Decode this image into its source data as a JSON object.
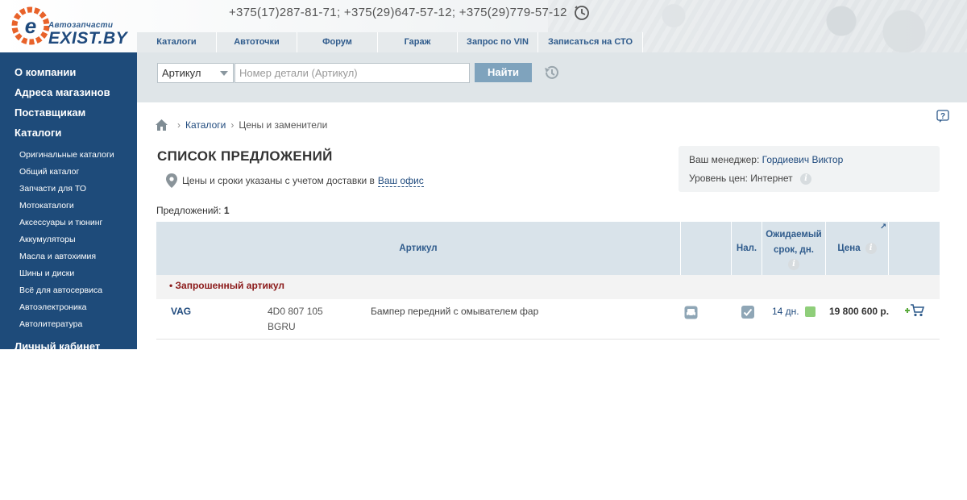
{
  "header": {
    "logo_small": "Автозапчасти",
    "logo_big": "EXIST.BY",
    "phones": "+375(17)287-81-71; +375(29)647-57-12; +375(29)779-57-12",
    "clock_icon": "clock-icon"
  },
  "topnav": [
    {
      "label": "Каталоги"
    },
    {
      "label": "Автоточки"
    },
    {
      "label": "Форум"
    },
    {
      "label": "Гараж"
    },
    {
      "label": "Запрос по VIN"
    },
    {
      "label": "Записаться на СТО"
    }
  ],
  "sidebar": {
    "main": [
      {
        "label": "О компании"
      },
      {
        "label": "Адреса магазинов"
      },
      {
        "label": "Поставщикам"
      },
      {
        "label": "Каталоги"
      }
    ],
    "sub": [
      {
        "label": "Оригинальные каталоги"
      },
      {
        "label": "Общий каталог"
      },
      {
        "label": "Запчасти для ТО"
      },
      {
        "label": "Мотокаталоги"
      },
      {
        "label": "Аксессуары и тюнинг"
      },
      {
        "label": "Аккумуляторы"
      },
      {
        "label": "Масла и автохимия"
      },
      {
        "label": "Шины и диски"
      },
      {
        "label": "Всё для автосервиса"
      },
      {
        "label": "Автоэлектроника"
      },
      {
        "label": "Автолитература"
      }
    ],
    "cabinet": "Личный кабинет"
  },
  "search": {
    "select_value": "Артикул",
    "placeholder": "Номер детали (Артикул)",
    "button": "Найти"
  },
  "breadcrumb": {
    "items": [
      "Каталоги",
      "Цены и заменители"
    ]
  },
  "page": {
    "title": "СПИСОК ПРЕДЛОЖЕНИЙ",
    "delivery_text": "Цены и сроки указаны с учетом доставки в",
    "delivery_link": "Ваш офис",
    "offers_label": "Предложений:",
    "offers_count": "1"
  },
  "manager": {
    "label": "Ваш менеджер:",
    "name": "Гордиевич Виктор",
    "price_level_label": "Уровень цен:",
    "price_level": "Интернет"
  },
  "table": {
    "headers": {
      "article": "Артикул",
      "stock": "Нал.",
      "expected_1": "Ожидаемый",
      "expected_2": "срок, дн.",
      "price": "Цена"
    },
    "group_label": "• Запрошенный артикул",
    "rows": [
      {
        "brand": "VAG",
        "article_1": "4D0 807 105",
        "article_2": "BGRU",
        "description": "Бампер передний с омывателем фар",
        "days": "14 дн.",
        "price": "19 800 600 р."
      }
    ]
  },
  "colors": {
    "brand_blue": "#1e4b7a",
    "accent_button": "#7fa3bd",
    "status_green": "#8fce7a",
    "group_red": "#8b1a1a"
  }
}
